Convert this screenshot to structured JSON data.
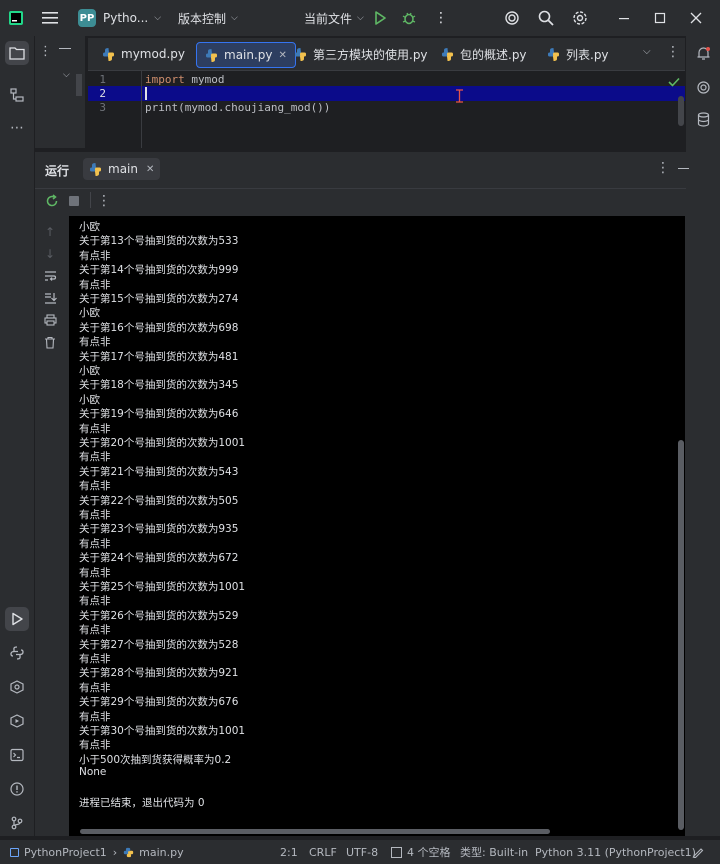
{
  "titlebar": {
    "project_badge": "PP",
    "project_name": "Pytho...",
    "vcs": "版本控制",
    "run_config": "当前文件"
  },
  "tabs": [
    {
      "label": "mymod.py",
      "active": false
    },
    {
      "label": "main.py",
      "active": true
    },
    {
      "label": "第三方模块的使用.py",
      "active": false
    },
    {
      "label": "包的概述.py",
      "active": false
    },
    {
      "label": "列表.py",
      "active": false
    }
  ],
  "editor": {
    "lines": [
      {
        "num": "1",
        "keyword": "import",
        "rest": " mymod"
      },
      {
        "num": "2",
        "keyword": "",
        "rest": ""
      },
      {
        "num": "3",
        "keyword": "",
        "rest": "print(mymod.choujiang_mod())"
      }
    ]
  },
  "run_panel": {
    "title": "运行",
    "tab_label": "main"
  },
  "console": {
    "lines": [
      "小欧",
      "关于第13个号抽到货的次数为533",
      "有点非",
      "关于第14个号抽到货的次数为999",
      "有点非",
      "关于第15个号抽到货的次数为274",
      "小欧",
      "关于第16个号抽到货的次数为698",
      "有点非",
      "关于第17个号抽到货的次数为481",
      "小欧",
      "关于第18个号抽到货的次数为345",
      "小欧",
      "关于第19个号抽到货的次数为646",
      "有点非",
      "关于第20个号抽到货的次数为1001",
      "有点非",
      "关于第21个号抽到货的次数为543",
      "有点非",
      "关于第22个号抽到货的次数为505",
      "有点非",
      "关于第23个号抽到货的次数为935",
      "有点非",
      "关于第24个号抽到货的次数为672",
      "有点非",
      "关于第25个号抽到货的次数为1001",
      "有点非",
      "关于第26个号抽到货的次数为529",
      "有点非",
      "关于第27个号抽到货的次数为528",
      "有点非",
      "关于第28个号抽到货的次数为921",
      "有点非",
      "关于第29个号抽到货的次数为676",
      "有点非",
      "关于第30个号抽到货的次数为1001",
      "有点非",
      "小于500次抽到货获得概率为0.2",
      "None",
      "",
      "进程已结束，退出代码为 0"
    ]
  },
  "statusbar": {
    "project": "PythonProject1",
    "file": "main.py",
    "position": "2:1",
    "line_sep": "CRLF",
    "encoding": "UTF-8",
    "indent": "4 个空格",
    "file_type": "类型: Built-in",
    "interpreter": "Python 3.11 (PythonProject1)"
  },
  "colors": {
    "accent": "#3574f0",
    "keyword": "#cf8e6d",
    "run_green": "#5fb865",
    "badge": "#3d8d94"
  }
}
